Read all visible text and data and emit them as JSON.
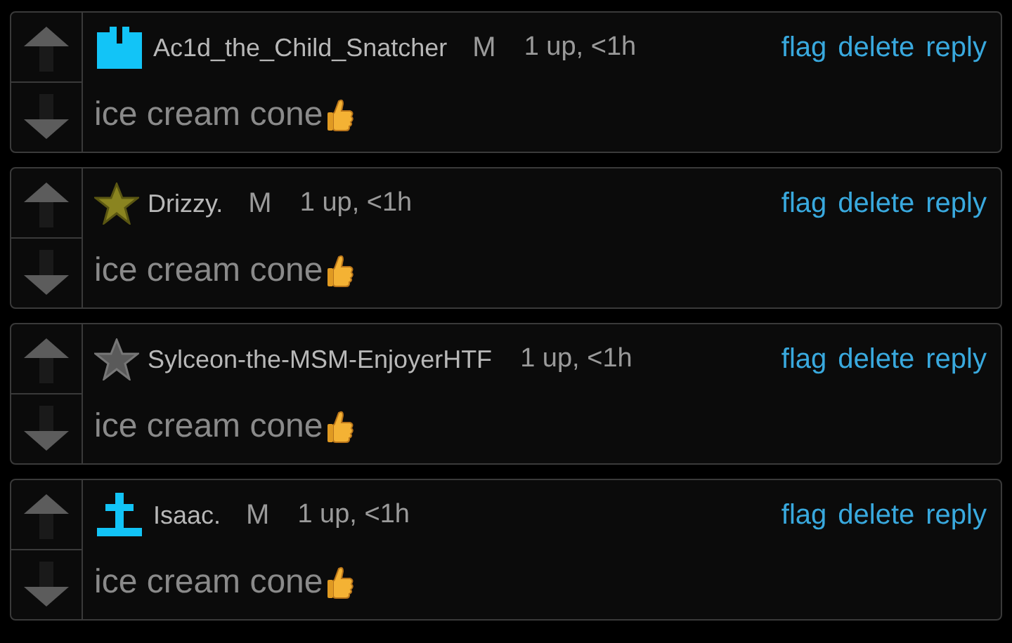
{
  "comments": [
    {
      "avatar": {
        "kind": "block"
      },
      "username": "Ac1d_the_Child_Snatcher",
      "badge": "M",
      "meta": "1 up, <1h",
      "actions": [
        "flag",
        "delete",
        "reply"
      ],
      "text": "ice cream cone"
    },
    {
      "avatar": {
        "kind": "gold-star"
      },
      "username": "Drizzy.",
      "badge": "M",
      "meta": "1 up, <1h",
      "actions": [
        "flag",
        "delete",
        "reply"
      ],
      "text": "ice cream cone"
    },
    {
      "avatar": {
        "kind": "gray-star"
      },
      "username": "Sylceon-the-MSM-EnjoyerHTF",
      "meta": "1 up, <1h",
      "actions": [
        "flag",
        "delete",
        "reply"
      ],
      "text": "ice cream cone"
    },
    {
      "avatar": {
        "kind": "cross"
      },
      "username": "Isaac.",
      "badge": "M",
      "meta": "1 up, <1h",
      "actions": [
        "flag",
        "delete",
        "reply"
      ],
      "text": "ice cream cone"
    }
  ]
}
